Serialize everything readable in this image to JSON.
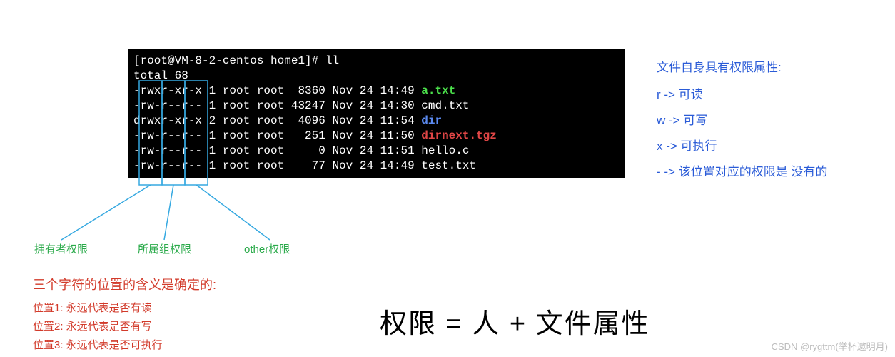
{
  "terminal": {
    "prompt": "[root@VM-8-2-centos home1]# ll",
    "total": "total 68",
    "rows": [
      {
        "perm": "-rwxr-xr-x",
        "links": "1",
        "owner": "root",
        "group": "root",
        "size": " 8360",
        "date": "Nov 24 14:49",
        "name": "a.txt",
        "cls": "f-green"
      },
      {
        "perm": "-rw-r--r--",
        "links": "1",
        "owner": "root",
        "group": "root",
        "size": "43247",
        "date": "Nov 24 14:30",
        "name": "cmd.txt",
        "cls": ""
      },
      {
        "perm": "drwxr-xr-x",
        "links": "2",
        "owner": "root",
        "group": "root",
        "size": " 4096",
        "date": "Nov 24 11:54",
        "name": "dir",
        "cls": "f-blue"
      },
      {
        "perm": "-rw-r--r--",
        "links": "1",
        "owner": "root",
        "group": "root",
        "size": "  251",
        "date": "Nov 24 11:50",
        "name": "dirnext.tgz",
        "cls": "f-red"
      },
      {
        "perm": "-rw-r--r--",
        "links": "1",
        "owner": "root",
        "group": "root",
        "size": "    0",
        "date": "Nov 24 11:51",
        "name": "hello.c",
        "cls": ""
      },
      {
        "perm": "-rw-r--r--",
        "links": "1",
        "owner": "root",
        "group": "root",
        "size": "   77",
        "date": "Nov 24 14:49",
        "name": "test.txt",
        "cls": ""
      }
    ]
  },
  "legend_right": {
    "title": "文件自身具有权限属性:",
    "r": "r  ->   可读",
    "w": "w ->   可写",
    "x": "x  ->   可执行",
    "dash": "-  ->   该位置对应的权限是 没有的"
  },
  "labels": {
    "owner": "拥有者权限",
    "group": "所属组权限",
    "other": "other权限"
  },
  "red": {
    "title": "三个字符的位置的含义是确定的:",
    "p1": "位置1: 永远代表是否有读",
    "p2": "位置2: 永远代表是否有写",
    "p3": "位置3: 永远代表是否可执行"
  },
  "formula": "权限 = 人 + 文件属性",
  "watermark": "CSDN @rygttm(举杯邀明月)"
}
